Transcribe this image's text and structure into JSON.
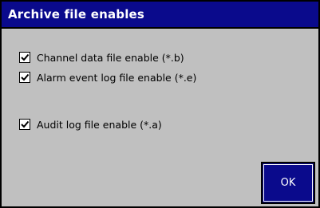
{
  "dialog": {
    "title": "Archive file enables"
  },
  "options": [
    {
      "label": "Channel data file enable (*.b)",
      "checked": true
    },
    {
      "label": "Alarm event log file enable (*.e)",
      "checked": true
    },
    {
      "label": "Audit log file enable (*.a)",
      "checked": true
    }
  ],
  "buttons": {
    "ok_label": "OK"
  },
  "colors": {
    "title_bar": "#0a0a8c",
    "dialog_background": "#c0c0c0",
    "button_background": "#0a0a8c"
  }
}
